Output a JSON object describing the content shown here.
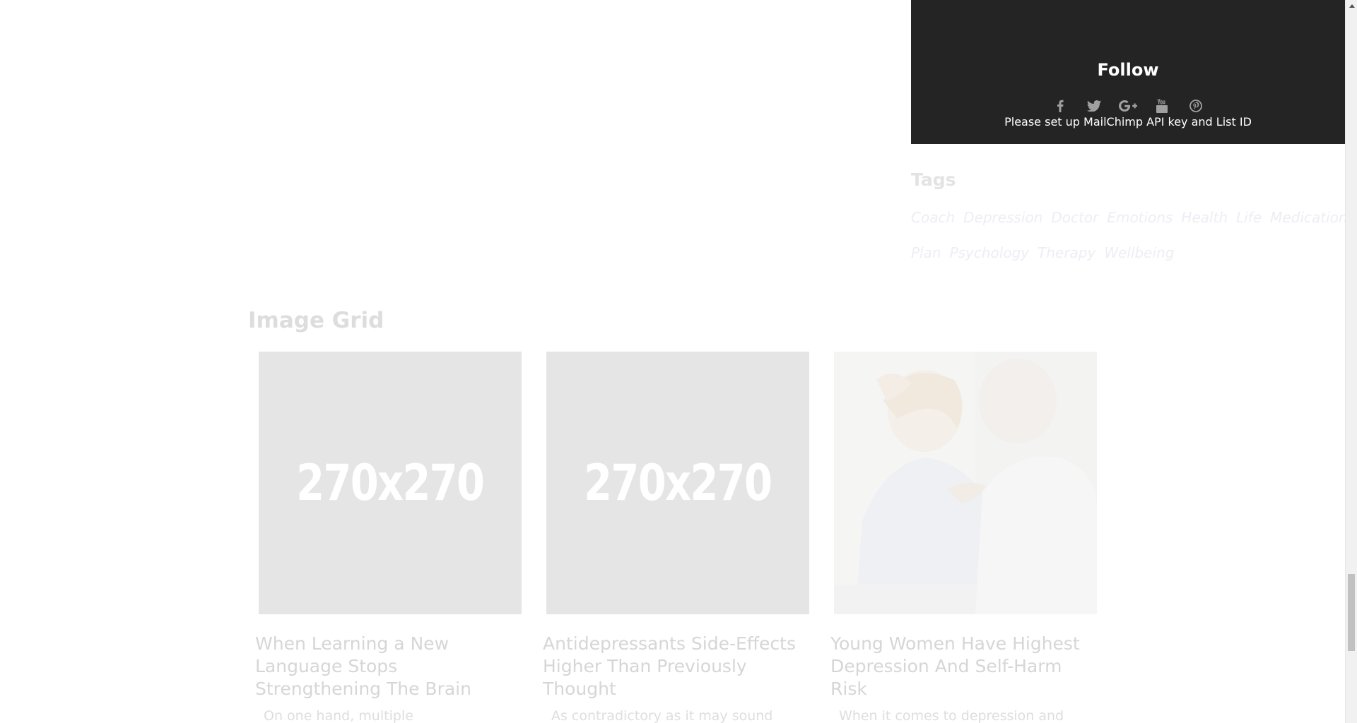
{
  "follow_widget": {
    "title": "Follow",
    "social_icons": [
      "facebook-icon",
      "twitter-icon",
      "google-plus-icon",
      "youtube-icon",
      "pinterest-icon"
    ],
    "mailchimp_note": "Please set up MailChimp API key and List ID"
  },
  "tags": {
    "heading": "Tags",
    "items": [
      "Coach",
      "Depression",
      "Doctor",
      "Emotions",
      "Health",
      "Life",
      "Medication",
      "Plan",
      "Psychology",
      "Therapy",
      "Wellbeing"
    ]
  },
  "image_grid": {
    "heading": "Image Grid",
    "cards": [
      {
        "thumb_label": "270x270",
        "title": "When Learning a New Language Stops Strengthening The Brain",
        "excerpt": "On one hand, multiple"
      },
      {
        "thumb_label": "270x270",
        "title": "Antidepressants Side-Effects Higher Than Previously Thought",
        "excerpt": "As contradictory as it may sound"
      },
      {
        "thumb_label": "",
        "title": "Young Women Have Highest Depression And Self-Harm Risk",
        "excerpt": "When it comes to depression and"
      }
    ]
  },
  "colors": {
    "widget_background": "#242424",
    "faded_text": "#dddddd",
    "placeholder": "#e5e5e5"
  }
}
